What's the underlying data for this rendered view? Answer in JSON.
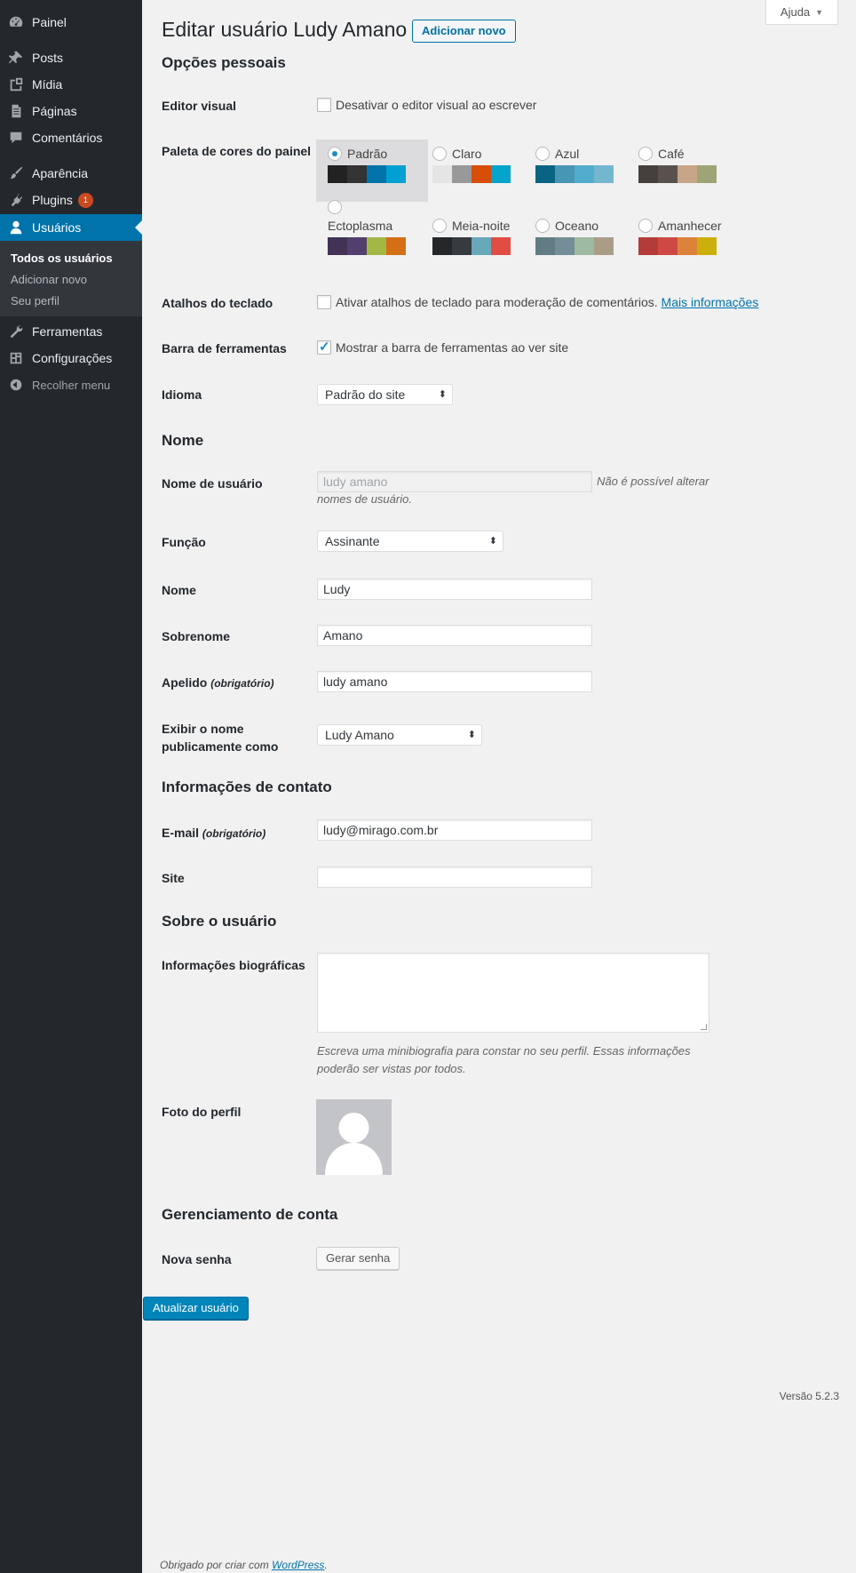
{
  "sidebar": {
    "items": [
      {
        "label": "Painel",
        "icon": "dashboard-icon"
      },
      {
        "label": "Posts",
        "icon": "pin-icon"
      },
      {
        "label": "Mídia",
        "icon": "media-icon"
      },
      {
        "label": "Páginas",
        "icon": "page-icon"
      },
      {
        "label": "Comentários",
        "icon": "comment-icon"
      },
      {
        "label": "Aparência",
        "icon": "brush-icon"
      },
      {
        "label": "Plugins",
        "icon": "plugin-icon",
        "badge": "1"
      },
      {
        "label": "Usuários",
        "icon": "user-icon"
      },
      {
        "label": "Ferramentas",
        "icon": "wrench-icon"
      },
      {
        "label": "Configurações",
        "icon": "settings-icon"
      },
      {
        "label": "Recolher menu",
        "icon": "collapse-icon"
      }
    ],
    "submenu": [
      "Todos os usuários",
      "Adicionar novo",
      "Seu perfil"
    ]
  },
  "header": {
    "help": "Ajuda",
    "title": "Editar usuário Ludy Amano",
    "add_new": "Adicionar novo"
  },
  "personal": {
    "heading": "Opções pessoais",
    "visual_editor_label": "Editor visual",
    "visual_editor_cb": "Desativar o editor visual ao escrever",
    "palette_label": "Paleta de cores do painel",
    "schemes": [
      {
        "name": "Padrão",
        "selected": true,
        "colors": [
          "#222222",
          "#333333",
          "#0073aa",
          "#00a0d2"
        ]
      },
      {
        "name": "Claro",
        "selected": false,
        "colors": [
          "#e5e5e5",
          "#999999",
          "#d64e07",
          "#04a4cc"
        ]
      },
      {
        "name": "Azul",
        "selected": false,
        "colors": [
          "#096484",
          "#4796b3",
          "#52accc",
          "#74b6ce"
        ]
      },
      {
        "name": "Café",
        "selected": false,
        "colors": [
          "#46403c",
          "#59524c",
          "#c7a589",
          "#9ea476"
        ]
      },
      {
        "name": "Ectoplasma",
        "selected": false,
        "colors": [
          "#413256",
          "#523f6d",
          "#a3b745",
          "#d46f15"
        ]
      },
      {
        "name": "Meia-noite",
        "selected": false,
        "colors": [
          "#25282b",
          "#363b3f",
          "#69a8bb",
          "#e14d43"
        ]
      },
      {
        "name": "Oceano",
        "selected": false,
        "colors": [
          "#627c83",
          "#738e96",
          "#9ebaa0",
          "#aa9d88"
        ]
      },
      {
        "name": "Amanhecer",
        "selected": false,
        "colors": [
          "#b43c38",
          "#cf4944",
          "#dd823b",
          "#ccaf0b"
        ]
      }
    ],
    "shortcuts_label": "Atalhos do teclado",
    "shortcuts_cb": "Ativar atalhos de teclado para moderação de comentários.",
    "shortcuts_link": "Mais informações",
    "toolbar_label": "Barra de ferramentas",
    "toolbar_cb": "Mostrar a barra de ferramentas ao ver site",
    "language_label": "Idioma",
    "language_value": "Padrão do site"
  },
  "name": {
    "heading": "Nome",
    "username_label": "Nome de usuário",
    "username_value": "ludy amano",
    "username_desc": "Não é possível alterar nomes de usuário.",
    "role_label": "Função",
    "role_value": "Assinante",
    "first_label": "Nome",
    "first_value": "Ludy",
    "last_label": "Sobrenome",
    "last_value": "Amano",
    "nick_label": "Apelido",
    "nick_required": "(obrigatório)",
    "nick_value": "ludy amano",
    "display_label": "Exibir o nome publicamente como",
    "display_value": "Ludy Amano"
  },
  "contact": {
    "heading": "Informações de contato",
    "email_label": "E-mail",
    "email_required": "(obrigatório)",
    "email_value": "ludy@mirago.com.br",
    "site_label": "Site",
    "site_value": ""
  },
  "about": {
    "heading": "Sobre o usuário",
    "bio_label": "Informações biográficas",
    "bio_desc": "Escreva uma minibiografia para constar no seu perfil. Essas informações poderão ser vistas por todos.",
    "photo_label": "Foto do perfil"
  },
  "account": {
    "heading": "Gerenciamento de conta",
    "password_label": "Nova senha",
    "generate_btn": "Gerar senha",
    "update_btn": "Atualizar usuário"
  },
  "footer": {
    "thanks": "Obrigado por criar com",
    "wp_link": "WordPress",
    "period": ".",
    "version": "Versão 5.2.3"
  }
}
